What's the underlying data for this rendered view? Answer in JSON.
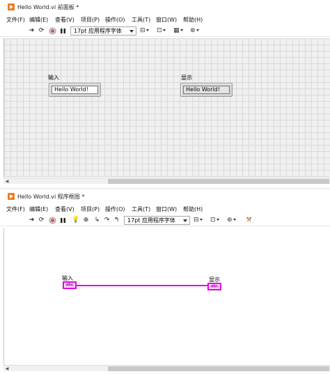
{
  "front_panel": {
    "title": "Hello World.vi 前面板 *",
    "menu": [
      "文件(F)",
      "编辑(E)",
      "查看(V)",
      "项目(P)",
      "操作(O)",
      "工具(T)",
      "窗口(W)",
      "帮助(H)"
    ],
    "font_select": "17pt 应用程序字体",
    "control": {
      "label": "输入",
      "value": "Hello World!"
    },
    "indicator": {
      "label": "显示",
      "value": "Hello World!"
    }
  },
  "block_diagram": {
    "title": "Hello World.vi 程序框图 *",
    "menu": [
      "文件(F)",
      "编辑(E)",
      "查看(V)",
      "项目(P)",
      "操作(O)",
      "工具(T)",
      "窗口(W)",
      "帮助(H)"
    ],
    "font_select": "17pt 应用程序字体",
    "control_terminal": {
      "label": "输入",
      "type": "abc"
    },
    "indicator_terminal": {
      "label": "显示",
      "type": "abc"
    },
    "wire_color": "#e000e0"
  },
  "icons": {
    "run": "run-arrow-icon",
    "run_continuous": "run-continuously-icon",
    "abort": "abort-icon",
    "pause": "pause-icon",
    "highlight": "highlight-execution-icon",
    "retain": "retain-wire-values-icon",
    "step_into": "step-into-icon",
    "step_over": "step-over-icon",
    "step_out": "step-out-icon",
    "align": "align-objects-icon",
    "distribute": "distribute-objects-icon",
    "resize": "resize-objects-icon",
    "reorder": "reorder-icon",
    "cleanup": "clean-up-diagram-icon"
  },
  "accent": "#f07b18"
}
